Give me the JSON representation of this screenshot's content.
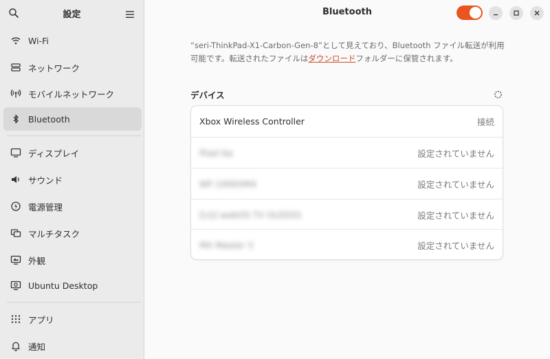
{
  "sidebar": {
    "title": "設定",
    "items": [
      {
        "label": "Wi-Fi",
        "icon": "wifi-icon"
      },
      {
        "label": "ネットワーク",
        "icon": "network-icon"
      },
      {
        "label": "モバイルネットワーク",
        "icon": "mobile-network-icon"
      },
      {
        "label": "Bluetooth",
        "icon": "bluetooth-icon",
        "active": true
      },
      {
        "label": "ディスプレイ",
        "icon": "display-icon"
      },
      {
        "label": "サウンド",
        "icon": "sound-icon"
      },
      {
        "label": "電源管理",
        "icon": "power-icon"
      },
      {
        "label": "マルチタスク",
        "icon": "multitask-icon"
      },
      {
        "label": "外観",
        "icon": "appearance-icon"
      },
      {
        "label": "Ubuntu Desktop",
        "icon": "ubuntu-desktop-icon"
      },
      {
        "label": "アプリ",
        "icon": "apps-icon"
      },
      {
        "label": "通知",
        "icon": "bell-icon"
      }
    ]
  },
  "header": {
    "title": "Bluetooth",
    "bluetooth_enabled": true,
    "accent_color": "#e95420"
  },
  "main": {
    "description_before": "“seri-ThinkPad-X1-Carbon-Gen-8”として見えており、Bluetooth ファイル転送が利用可能です。転送されたファイルは",
    "description_link": "ダウンロード",
    "description_after": "フォルダーに保管されます。",
    "devices_title": "デバイス",
    "devices": [
      {
        "name": "Xbox Wireless Controller",
        "status": "接続"
      },
      {
        "name": "Pixel 6a",
        "status": "設定されていません",
        "blurred": true
      },
      {
        "name": "WF-1000XM4",
        "status": "設定されていません",
        "blurred": true
      },
      {
        "name": "[LG] webOS TV OLED55",
        "status": "設定されていません",
        "blurred": true
      },
      {
        "name": "MX Master 3",
        "status": "設定されていません",
        "blurred": true
      }
    ]
  }
}
